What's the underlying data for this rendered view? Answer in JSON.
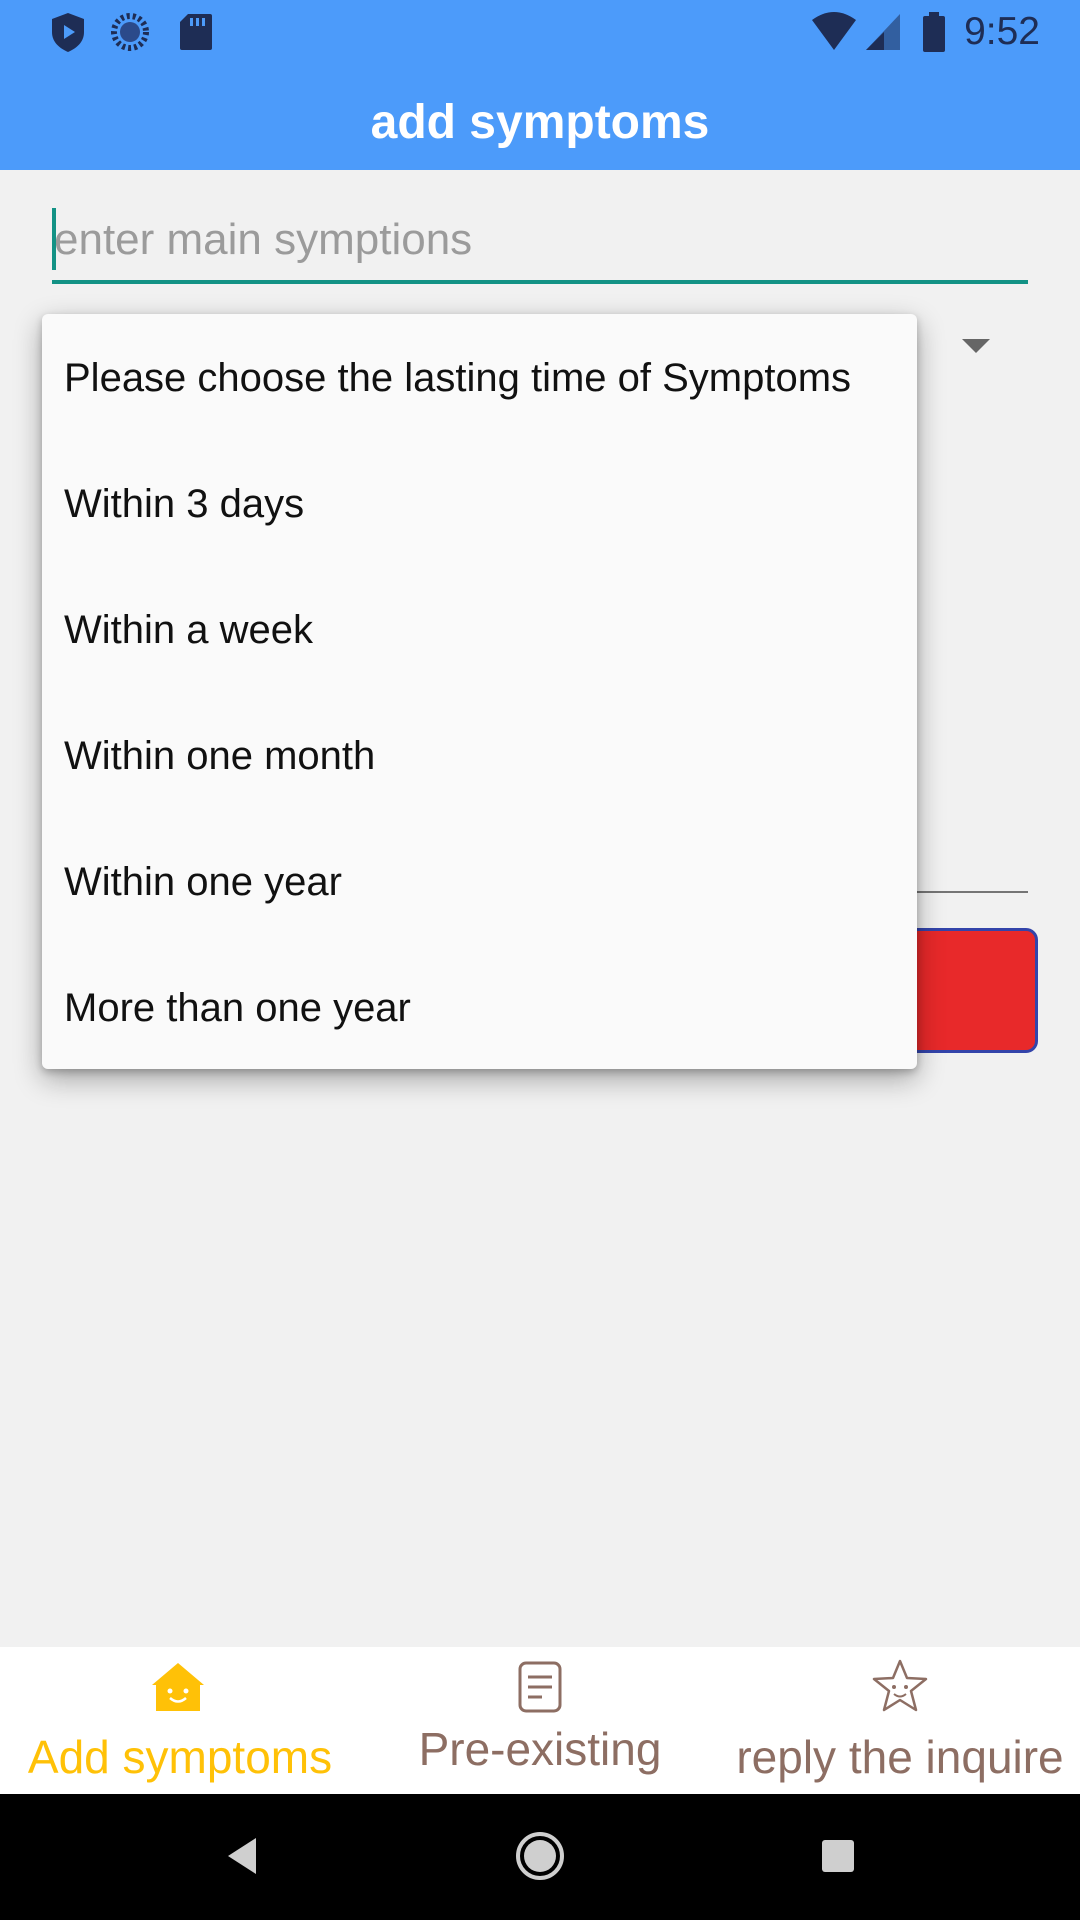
{
  "status_bar": {
    "time": "9:52",
    "left_icons": [
      "shield-icon",
      "sync-icon",
      "sd-card-icon"
    ],
    "right_icons": [
      "wifi-icon",
      "signal-icon",
      "battery-icon"
    ]
  },
  "app_bar": {
    "title": "add symptoms"
  },
  "form": {
    "symptom_input": {
      "placeholder": "enter main symptions",
      "value": ""
    }
  },
  "dropdown": {
    "options": [
      "Please choose the lasting time of Symptoms",
      "Within 3 days",
      "Within a week",
      "Within one month",
      "Within one year",
      "More than one year"
    ]
  },
  "bottom_nav": {
    "items": [
      {
        "label": "Add symptoms",
        "icon": "home-icon",
        "active": true
      },
      {
        "label": "Pre-existing",
        "icon": "document-icon",
        "active": false
      },
      {
        "label": "reply the inquire",
        "icon": "star-icon",
        "active": false
      }
    ]
  },
  "colors": {
    "primary": "#4c9bfa",
    "accent": "#139285",
    "active_nav": "#ffc107",
    "inactive_nav": "#8d6e63",
    "button_red": "#e8292a"
  }
}
